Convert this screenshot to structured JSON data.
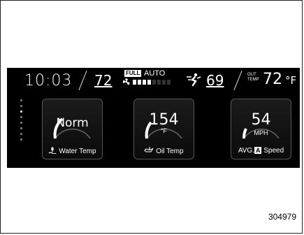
{
  "status_bar": {
    "time": "10:03",
    "driver_temp": "72",
    "fan_mode": "FULL",
    "climate_mode": "AUTO",
    "fan_speed_level": 0.5,
    "passenger_temp": "69",
    "outside_label_line1": "OUT",
    "outside_label_line2": "TEMP",
    "outside_temp": "72",
    "outside_unit": "°F"
  },
  "page_indicator": {
    "count": 8,
    "active_index": 2
  },
  "gauges": [
    {
      "value": "Norm",
      "unit": "",
      "label": "Water Temp",
      "icon": "water-temp-icon"
    },
    {
      "value": "154",
      "unit": "°F",
      "label": "Oil Temp",
      "icon": "oil-temp-icon"
    },
    {
      "value": "54",
      "unit": "MPH",
      "label_prefix": "AVG.",
      "label_badge": "A",
      "label": "Speed",
      "icon": ""
    }
  ],
  "figure_id": "304979",
  "colors": {
    "display_bg": "#000000",
    "text": "#ffffff",
    "tile_border": "#555555"
  }
}
